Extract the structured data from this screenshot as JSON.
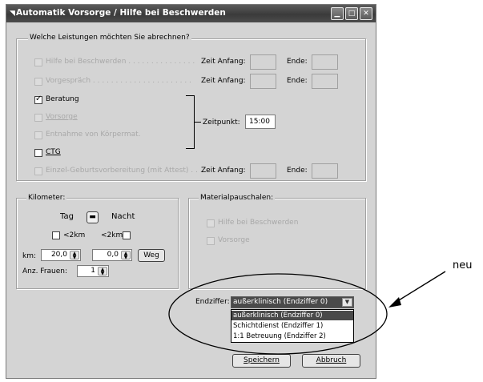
{
  "window": {
    "title": "Automatik Vorsorge / Hilfe bei Beschwerden"
  },
  "leistungen": {
    "legend": "Welche Leistungen möchten Sie abrechnen?",
    "items": [
      {
        "label": "Hilfe bei Beschwerden . . . . . . . . . . . . . . .",
        "checked": false,
        "enabled": false
      },
      {
        "label": "Vorgespräch . . . . . . . . . . . . . . . . . . . . . .",
        "checked": false,
        "enabled": false
      },
      {
        "label": "Beratung",
        "checked": true,
        "enabled": true
      },
      {
        "label": "Vorsorge",
        "checked": false,
        "enabled": false
      },
      {
        "label": "Entnahme von Körpermat.",
        "checked": false,
        "enabled": false
      },
      {
        "label": "CTG",
        "checked": false,
        "enabled": true
      },
      {
        "label": "Einzel-Geburtsvorbereitung (mit Attest) . . . .",
        "checked": false,
        "enabled": false
      }
    ],
    "zeit_anfang_label": "Zeit Anfang:",
    "ende_label": "Ende:",
    "zeitpunkt_label": "Zeitpunkt:",
    "zeitpunkt_value": "15:00"
  },
  "kilometer": {
    "legend": "Kilometer:",
    "tag_label": "Tag",
    "nacht_label": "Nacht",
    "lt2km_left": "<2km",
    "lt2km_right": "<2km",
    "km_label": "km:",
    "km_value_1": "20,0",
    "km_value_2": "0,0",
    "weg_button": "Weg",
    "frauen_label": "Anz. Frauen:",
    "frauen_value": "1"
  },
  "material": {
    "legend": "Materialpauschalen:",
    "items": [
      {
        "label": "Hilfe bei Beschwerden",
        "checked": false
      },
      {
        "label": "Vorsorge",
        "checked": false
      }
    ]
  },
  "endziffer": {
    "label": "Endziffer:",
    "selected": "außerklinisch (Endziffer 0)",
    "options": [
      "außerklinisch (Endziffer 0)",
      "Schichtdienst (Endziffer 1)",
      "1:1 Betreuung (Endziffer 2)"
    ]
  },
  "buttons": {
    "save": "Speichern",
    "cancel": "Abbruch"
  },
  "annotation": {
    "label": "neu"
  },
  "colors": {
    "titlebar": "#3a3a3a",
    "window_bg": "#d4d4d4",
    "selection": "#4a4a4a"
  }
}
